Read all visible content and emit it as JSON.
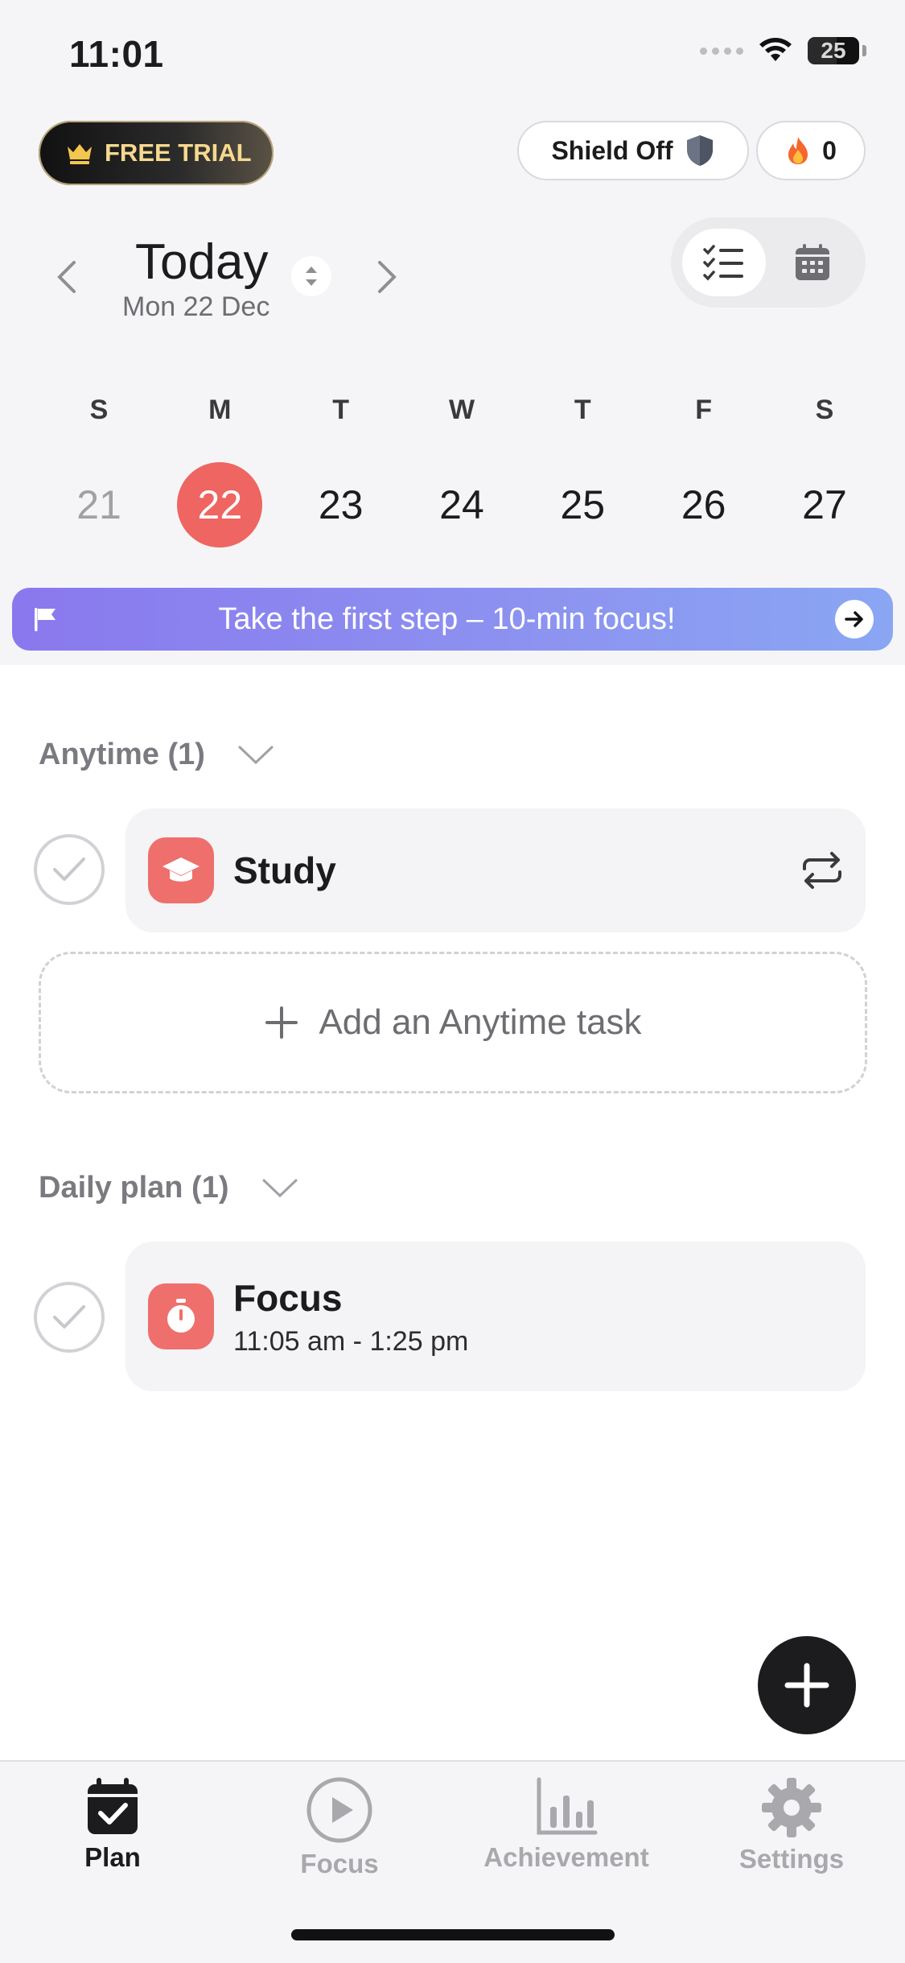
{
  "status_bar": {
    "time": "11:01",
    "battery": "25"
  },
  "header": {
    "free_trial_label": "FREE TRIAL",
    "shield_label": "Shield Off",
    "streak_count": "0",
    "title": "Today",
    "date": "Mon 22 Dec"
  },
  "week": [
    {
      "letter": "S",
      "num": "21"
    },
    {
      "letter": "M",
      "num": "22"
    },
    {
      "letter": "T",
      "num": "23"
    },
    {
      "letter": "W",
      "num": "24"
    },
    {
      "letter": "T",
      "num": "25"
    },
    {
      "letter": "F",
      "num": "26"
    },
    {
      "letter": "S",
      "num": "27"
    }
  ],
  "banner": {
    "text": "Take the first step – 10-min focus!"
  },
  "anytime": {
    "title": "Anytime (1)",
    "task": {
      "title": "Study"
    },
    "add_label": "Add an Anytime task"
  },
  "daily": {
    "title": "Daily plan (1)",
    "task": {
      "title": "Focus",
      "time": "11:05 am - 1:25 pm"
    }
  },
  "tabs": [
    {
      "label": "Plan",
      "icon": "calendar-check-icon",
      "active": true
    },
    {
      "label": "Focus",
      "icon": "play-circle-icon",
      "active": false
    },
    {
      "label": "Achievement",
      "icon": "bar-chart-icon",
      "active": false
    },
    {
      "label": "Settings",
      "icon": "gear-icon",
      "active": false
    }
  ],
  "colors": {
    "accent_red": "#ee6562",
    "banner_gradient_start": "#8a78ee",
    "banner_gradient_end": "#8aa6f3",
    "tab_inactive": "#a8a8ad"
  }
}
